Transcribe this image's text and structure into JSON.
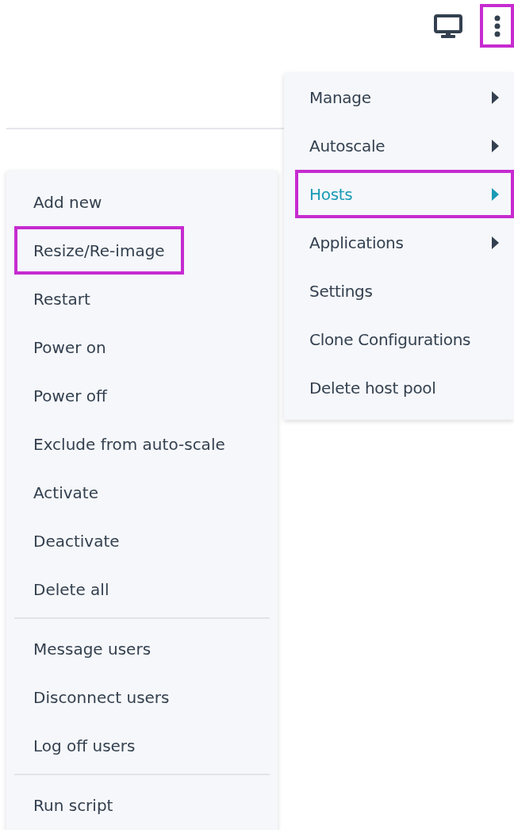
{
  "toolbar": {
    "buttons": [
      {
        "kind": "monitor",
        "highlighted": false
      },
      {
        "kind": "more",
        "highlighted": true
      }
    ]
  },
  "menu": {
    "items": [
      {
        "label": "Manage",
        "has_submenu": true,
        "selected": false,
        "highlighted": false
      },
      {
        "label": "Autoscale",
        "has_submenu": true,
        "selected": false,
        "highlighted": false
      },
      {
        "label": "Hosts",
        "has_submenu": true,
        "selected": true,
        "highlighted": true
      },
      {
        "label": "Applications",
        "has_submenu": true,
        "selected": false,
        "highlighted": false
      },
      {
        "label": "Settings",
        "has_submenu": false,
        "selected": false,
        "highlighted": false
      },
      {
        "label": "Clone Configurations",
        "has_submenu": false,
        "selected": false,
        "highlighted": false
      },
      {
        "label": "Delete host pool",
        "has_submenu": false,
        "selected": false,
        "highlighted": false
      }
    ]
  },
  "submenu": {
    "groups": [
      {
        "items": [
          {
            "label": "Add new",
            "highlighted": false
          },
          {
            "label": "Resize/Re-image",
            "highlighted": true
          },
          {
            "label": "Restart",
            "highlighted": false
          },
          {
            "label": "Power on",
            "highlighted": false
          },
          {
            "label": "Power off",
            "highlighted": false
          },
          {
            "label": "Exclude from auto-scale",
            "highlighted": false
          },
          {
            "label": "Activate",
            "highlighted": false
          },
          {
            "label": "Deactivate",
            "highlighted": false
          },
          {
            "label": "Delete all",
            "highlighted": false
          }
        ]
      },
      {
        "items": [
          {
            "label": "Message users",
            "highlighted": false
          },
          {
            "label": "Disconnect users",
            "highlighted": false
          },
          {
            "label": "Log off users",
            "highlighted": false
          }
        ]
      },
      {
        "items": [
          {
            "label": "Run script",
            "highlighted": false
          }
        ]
      }
    ]
  }
}
